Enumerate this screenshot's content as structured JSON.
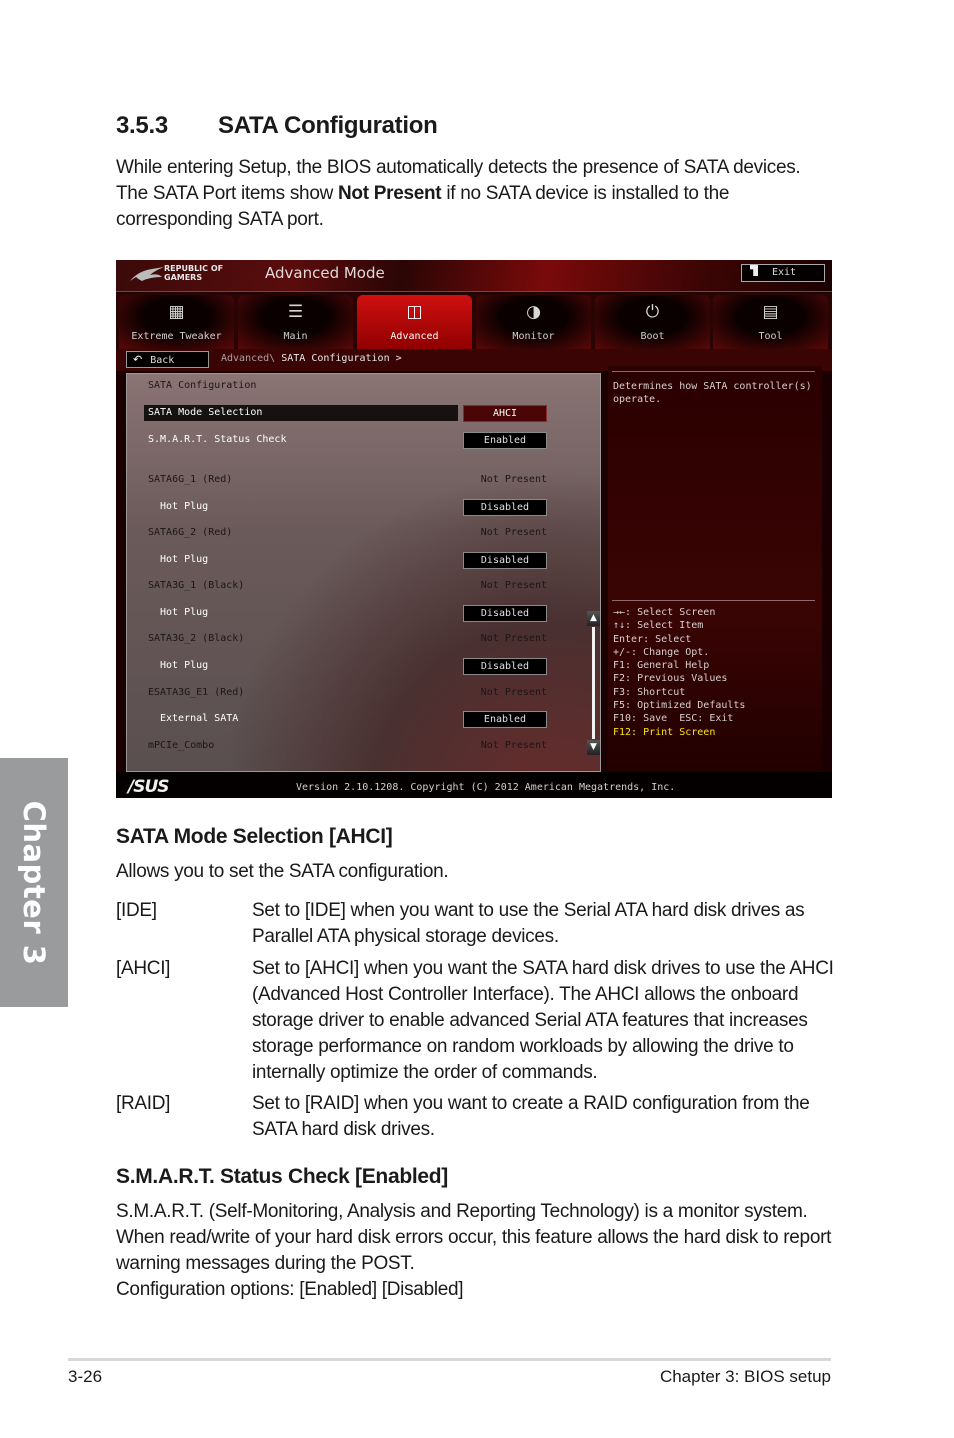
{
  "section": {
    "number": "3.5.3",
    "title": "SATA Configuration",
    "intro_line1": "While entering Setup, the BIOS automatically detects the presence of SATA devices.",
    "intro_line2_pre": "The SATA Port items show ",
    "intro_line2_bold": "Not Present",
    "intro_line2_post": " if no SATA device is installed to the",
    "intro_line3": "corresponding SATA port."
  },
  "bios": {
    "brand_line1": "REPUBLIC OF",
    "brand_line2": "GAMERS",
    "mode_title": "Advanced Mode",
    "exit_label": "Exit",
    "tabs": [
      {
        "label": "Extreme Tweaker",
        "icon": "cpu-cooler-icon",
        "active": false
      },
      {
        "label": "Main",
        "icon": "list-icon",
        "active": false
      },
      {
        "label": "Advanced",
        "icon": "advanced-info-icon",
        "active": true
      },
      {
        "label": "Monitor",
        "icon": "thermometer-icon",
        "active": false
      },
      {
        "label": "Boot",
        "icon": "power-icon",
        "active": false
      },
      {
        "label": "Tool",
        "icon": "toolbox-icon",
        "active": false
      }
    ],
    "back_label": "Back",
    "breadcrumb_parent": "Advanced\\",
    "breadcrumb_current": "SATA Configuration >",
    "settings_header": "SATA Configuration",
    "items": [
      {
        "label": "SATA Mode Selection",
        "value": "AHCI",
        "type": "select",
        "selected": true
      },
      {
        "label": "S.M.A.R.T. Status Check",
        "value": "Enabled",
        "type": "select"
      },
      {
        "label": "SATA6G_1 (Red)",
        "value": "Not Present",
        "type": "info"
      },
      {
        "label": "Hot Plug",
        "value": "Disabled",
        "type": "select"
      },
      {
        "label": "SATA6G_2 (Red)",
        "value": "Not Present",
        "type": "info"
      },
      {
        "label": "Hot Plug",
        "value": "Disabled",
        "type": "select"
      },
      {
        "label": "SATA3G_1 (Black)",
        "value": "Not Present",
        "type": "info"
      },
      {
        "label": "Hot Plug",
        "value": "Disabled",
        "type": "select"
      },
      {
        "label": "SATA3G_2 (Black)",
        "value": "Not Present",
        "type": "info"
      },
      {
        "label": "Hot Plug",
        "value": "Disabled",
        "type": "select"
      },
      {
        "label": "ESATA3G_E1 (Red)",
        "value": "Not Present",
        "type": "info"
      },
      {
        "label": "External SATA",
        "value": "Enabled",
        "type": "select"
      },
      {
        "label": "mPCIe_Combo",
        "value": "Not Present",
        "type": "info"
      }
    ],
    "help_text": "Determines how SATA controller(s) operate.",
    "keys": [
      "→←: Select Screen",
      "↑↓: Select Item",
      "Enter: Select",
      "+/-: Change Opt.",
      "F1: General Help",
      "F2: Previous Values",
      "F3: Shortcut",
      "F5: Optimized Defaults",
      "F10: Save  ESC: Exit",
      "F12: Print Screen"
    ],
    "asus_logo": "/SUS",
    "version": "Version 2.10.1208. Copyright (C) 2012 American Megatrends, Inc.",
    "colors": {
      "accent_red": "#c00000",
      "highlight_key": "#ffe600"
    }
  },
  "sata_mode": {
    "heading": "SATA Mode Selection [AHCI]",
    "intro": "Allows you to set the SATA configuration.",
    "options": [
      {
        "term": "[IDE]",
        "desc": "Set to [IDE] when you want to use the Serial ATA hard disk drives as Parallel ATA physical storage devices."
      },
      {
        "term": "[AHCI]",
        "desc": "Set to [AHCI] when you want the SATA hard disk drives to use the AHCI (Advanced Host Controller Interface). The AHCI allows the onboard storage driver to enable advanced Serial ATA features that increases storage performance on random workloads by allowing the drive to internally optimize the order of commands."
      },
      {
        "term": "[RAID]",
        "desc": "Set to [RAID] when you want to create a RAID configuration from the SATA hard disk drives."
      }
    ]
  },
  "smart": {
    "heading": "S.M.A.R.T. Status Check [Enabled]",
    "body": "S.M.A.R.T. (Self-Monitoring, Analysis and Reporting Technology) is a monitor system. When read/write of your hard disk errors occur, this feature allows the hard disk to report warning messages during the POST.",
    "options": "Configuration options: [Enabled] [Disabled]"
  },
  "chapter_tab": "Chapter 3",
  "footer": {
    "page_number": "3-26",
    "chapter_title": "Chapter 3: BIOS setup"
  }
}
